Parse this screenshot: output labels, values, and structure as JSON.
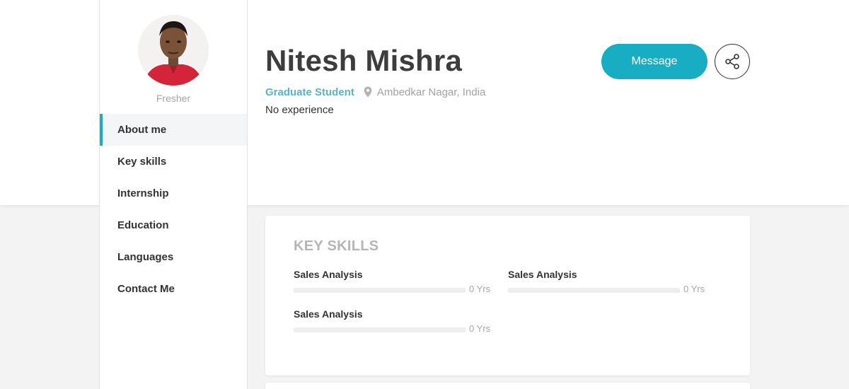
{
  "profile": {
    "name": "Nitesh Mishra",
    "role": "Fresher",
    "title": "Graduate Student",
    "location": "Ambedkar Nagar, India",
    "experience": "No experience"
  },
  "actions": {
    "message_label": "Message",
    "share_icon": "share-icon"
  },
  "icons": {
    "location": "map-pin-icon",
    "avatar": "profile-photo"
  },
  "nav": {
    "active_index": 0,
    "items": [
      {
        "label": "About me"
      },
      {
        "label": "Key skills"
      },
      {
        "label": "Internship"
      },
      {
        "label": "Education"
      },
      {
        "label": "Languages"
      },
      {
        "label": "Contact Me"
      }
    ]
  },
  "key_skills": {
    "title": "KEY SKILLS",
    "items": [
      {
        "name": "Sales Analysis",
        "years": "0 Yrs",
        "level": 0
      },
      {
        "name": "Sales Analysis",
        "years": "0 Yrs",
        "level": 0
      },
      {
        "name": "Sales Analysis",
        "years": "0 Yrs",
        "level": 0
      }
    ]
  },
  "colors": {
    "accent": "#17aec4",
    "student_text": "#5ab4c4",
    "muted_text": "#a6a6a6",
    "page_background": "#f3f3f3"
  }
}
